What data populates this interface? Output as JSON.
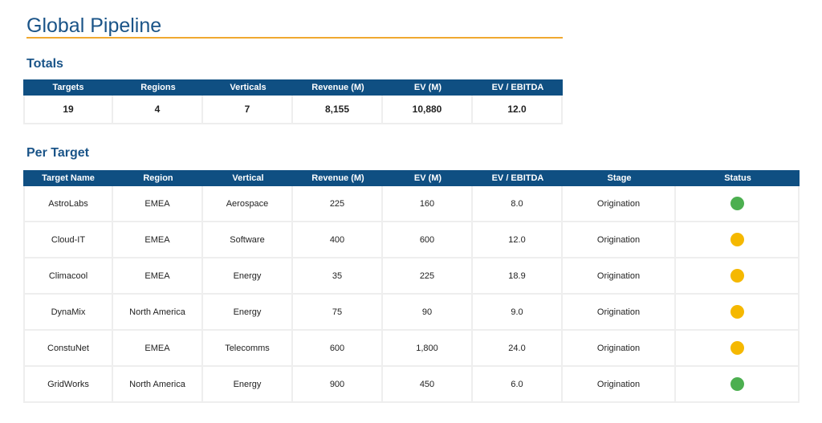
{
  "title": "Global Pipeline",
  "totals": {
    "heading": "Totals",
    "columns": [
      "Targets",
      "Regions",
      "Verticals",
      "Revenue (M)",
      "EV (M)",
      "EV / EBITDA"
    ],
    "values": [
      "19",
      "4",
      "7",
      "8,155",
      "10,880",
      "12.0"
    ]
  },
  "per_target": {
    "heading": "Per Target",
    "columns": [
      "Target Name",
      "Region",
      "Vertical",
      "Revenue (M)",
      "EV (M)",
      "EV / EBITDA",
      "Stage",
      "Status"
    ],
    "rows": [
      {
        "name": "AstroLabs",
        "region": "EMEA",
        "vertical": "Aerospace",
        "revenue": "225",
        "ev": "160",
        "ev_ebitda": "8.0",
        "stage": "Origination",
        "status": "green"
      },
      {
        "name": "Cloud-IT",
        "region": "EMEA",
        "vertical": "Software",
        "revenue": "400",
        "ev": "600",
        "ev_ebitda": "12.0",
        "stage": "Origination",
        "status": "amber"
      },
      {
        "name": "Climacool",
        "region": "EMEA",
        "vertical": "Energy",
        "revenue": "35",
        "ev": "225",
        "ev_ebitda": "18.9",
        "stage": "Origination",
        "status": "amber"
      },
      {
        "name": "DynaMix",
        "region": "North America",
        "vertical": "Energy",
        "revenue": "75",
        "ev": "90",
        "ev_ebitda": "9.0",
        "stage": "Origination",
        "status": "amber"
      },
      {
        "name": "ConstuNet",
        "region": "EMEA",
        "vertical": "Telecomms",
        "revenue": "600",
        "ev": "1,800",
        "ev_ebitda": "24.0",
        "stage": "Origination",
        "status": "amber"
      },
      {
        "name": "GridWorks",
        "region": "North America",
        "vertical": "Energy",
        "revenue": "900",
        "ev": "450",
        "ev_ebitda": "6.0",
        "stage": "Origination",
        "status": "green"
      }
    ]
  },
  "colors": {
    "brand_blue": "#1a5488",
    "header_blue": "#0f4f82",
    "accent_orange": "#f0a830",
    "status_green": "#4caf50",
    "status_amber": "#f5b800"
  }
}
